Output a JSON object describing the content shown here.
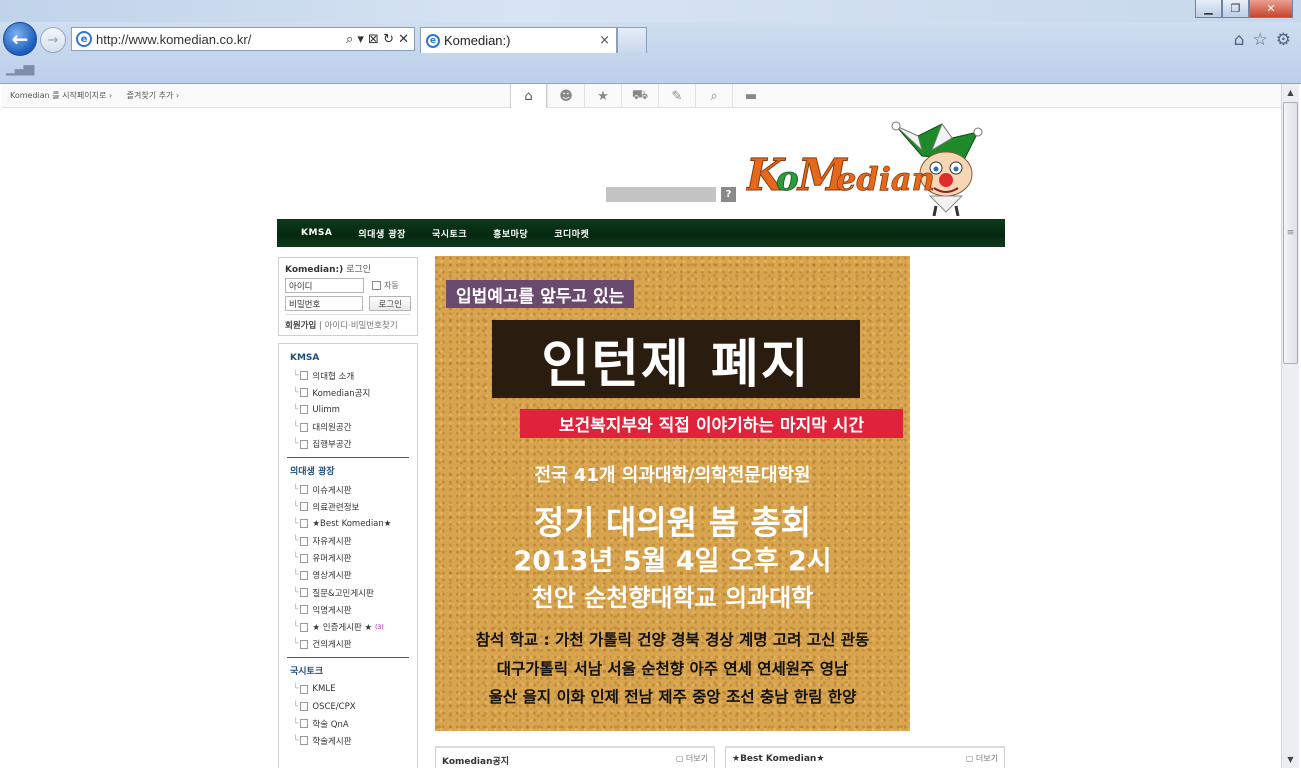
{
  "browser": {
    "url": "http://www.komedian.co.kr/",
    "tab_title": "Komedian:)",
    "tab_close": "×",
    "back_glyph": "←",
    "forward_glyph": "→",
    "addr_controls": "⌕ ▾ ⊠ ↻ ✕",
    "window_buttons": [
      "▁",
      "❐",
      "✕"
    ],
    "right_icons": [
      "home-icon",
      "star-icon",
      "gear-icon"
    ],
    "accent": "#1a5bbf"
  },
  "topbar": {
    "links": [
      "Komedian 를 시작페이지로 ›",
      "즐겨찾기 추가 ›"
    ],
    "icons": [
      "home-icon",
      "people-icon",
      "star-icon",
      "cart-icon",
      "tools-icon",
      "search-icon",
      "car-icon"
    ]
  },
  "search": {
    "button": "?"
  },
  "logo": {
    "text": "KoMedian"
  },
  "gnb": {
    "items": [
      "KMSA",
      "의대생 광장",
      "국시토크",
      "홍보마당",
      "코디마켓"
    ],
    "color": "#042810"
  },
  "login": {
    "title_brand": "Komedian:)",
    "title_suffix": "로그인",
    "id_placeholder": "아이디",
    "pw_placeholder": "비밀번호",
    "save_label": "자동",
    "login_button": "로그인",
    "join": "회원가입",
    "find": "아이디·비밀번호찾기"
  },
  "menu": {
    "sections": [
      {
        "title": "KMSA",
        "items": [
          "의대협 소개",
          "Komedian공지",
          "Ulimm",
          "대의원공간",
          "집행부공간"
        ]
      },
      {
        "title": "의대생 광장",
        "items": [
          "이슈게시판",
          "의료관련정보",
          "★Best Komedian★",
          "자유게시판",
          "유머게시판",
          "영상게시판",
          "질문&고민게시판",
          "익명게시판",
          "★ 인증게시판 ★",
          "건의게시판"
        ],
        "badge_index": 8,
        "badge": "(3)"
      },
      {
        "title": "국시토크",
        "items": [
          "KMLE",
          "OSCE/CPX",
          "학술 QnA",
          "학술게시판"
        ]
      }
    ]
  },
  "poster": {
    "tag": "입법예고를 앞두고 있는",
    "headline": "인턴제 폐지",
    "red_banner": "보건복지부와 직접 이야기하는 마지막 시간",
    "line1": "전국 41개 의과대학/의학전문대학원",
    "line2": "정기 대의원 봄 총회",
    "line3": "2013년 5월 4일 오후 2시",
    "line4": "천안 순천향대학교 의과대학",
    "schools1": "참석 학교 : 가천 가톨릭 건양 경북 경상 계명 고려 고신 관동",
    "schools2": "대구가톨릭 서남 서울 순천향 아주 연세 연세원주 영남",
    "schools3": "울산 을지 이화 인제 전남 제주 중앙 조선 충남 한림 한양",
    "colors": {
      "background": "#d8a44d",
      "tag": "#6b4a6f",
      "headline_bg": "#2a1d10",
      "banner": "#e0223a"
    }
  },
  "boards": [
    {
      "title": "Komedian공지",
      "more": "▢ 더보기"
    },
    {
      "title": "★Best Komedian★",
      "more": "▢ 더보기"
    }
  ]
}
